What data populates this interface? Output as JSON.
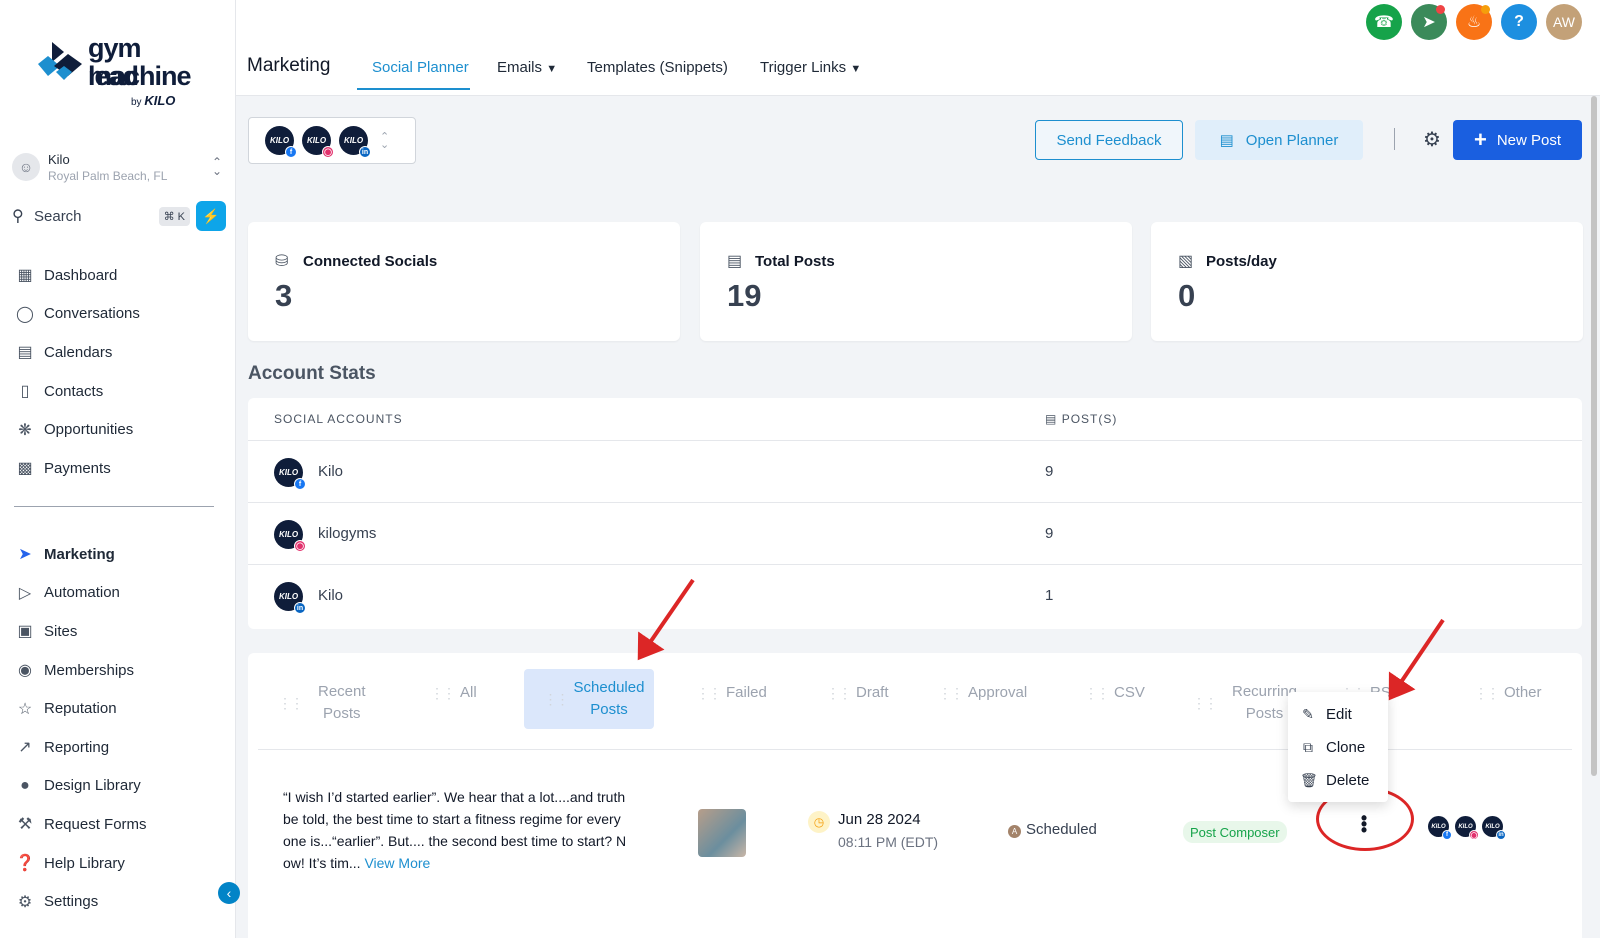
{
  "brand": {
    "logo_line1": "gym lead",
    "logo_line2": "machine",
    "logo_by": "by",
    "logo_by_brand": "KILO"
  },
  "account": {
    "name": "Kilo",
    "location": "Royal Palm Beach, FL"
  },
  "search": {
    "label": "Search",
    "shortcut": "⌘ K"
  },
  "sidebar": {
    "items": [
      {
        "label": "Dashboard",
        "icon": "dashboard-icon"
      },
      {
        "label": "Conversations",
        "icon": "chat-icon"
      },
      {
        "label": "Calendars",
        "icon": "calendar-icon"
      },
      {
        "label": "Contacts",
        "icon": "contacts-icon"
      },
      {
        "label": "Opportunities",
        "icon": "opportunities-icon"
      },
      {
        "label": "Payments",
        "icon": "payments-icon"
      }
    ],
    "items2": [
      {
        "label": "Marketing",
        "icon": "send-icon"
      },
      {
        "label": "Automation",
        "icon": "automation-icon"
      },
      {
        "label": "Sites",
        "icon": "sites-icon"
      },
      {
        "label": "Memberships",
        "icon": "memberships-icon"
      },
      {
        "label": "Reputation",
        "icon": "star-icon"
      },
      {
        "label": "Reporting",
        "icon": "chart-icon"
      },
      {
        "label": "Design Library",
        "icon": "palette-icon"
      },
      {
        "label": "Request Forms",
        "icon": "wrench-icon"
      },
      {
        "label": "Help Library",
        "icon": "help-icon"
      },
      {
        "label": "Settings",
        "icon": "gear-icon"
      }
    ]
  },
  "header": {
    "title": "Marketing",
    "tabs": [
      "Social Planner",
      "Emails",
      "Templates (Snippets)",
      "Trigger Links"
    ],
    "user_initials": "AW"
  },
  "toolbar": {
    "send_feedback": "Send Feedback",
    "open_planner": "Open Planner",
    "new_post": "New Post"
  },
  "stats": [
    {
      "label": "Connected Socials",
      "value": "3"
    },
    {
      "label": "Total Posts",
      "value": "19"
    },
    {
      "label": "Posts/day",
      "value": "0"
    }
  ],
  "account_stats": {
    "title": "Account Stats",
    "col_accounts": "SOCIAL ACCOUNTS",
    "col_posts": "POST(S)",
    "rows": [
      {
        "name": "Kilo",
        "network": "facebook",
        "posts": "9"
      },
      {
        "name": "kilogyms",
        "network": "instagram",
        "posts": "9"
      },
      {
        "name": "Kilo",
        "network": "linkedin",
        "posts": "1"
      }
    ]
  },
  "post_tabs": {
    "recent1": "Recent",
    "recent2": "Posts",
    "all": "All",
    "scheduled1": "Scheduled",
    "scheduled2": "Posts",
    "failed": "Failed",
    "draft": "Draft",
    "approval": "Approval",
    "csv": "CSV",
    "recurring1": "Recurring",
    "recurring2": "Posts",
    "rss": "RS",
    "other": "Other"
  },
  "post": {
    "text": "“I wish I’d started earlier”. We hear that a lot....and truth be told, the best time to start a fitness regime for everyone is...“earlier”.  But.... the second best time to start? Now! It’s tim...",
    "view_more": "View More",
    "date": "Jun 28 2024",
    "time": "08:11 PM (EDT)",
    "status": "Scheduled",
    "source": "Post Composer",
    "kebab": "⋮"
  },
  "menu": {
    "edit": "Edit",
    "clone": "Clone",
    "delete": "Delete"
  },
  "avatar_text": "KILO",
  "colors": {
    "accent": "#1d8fcf",
    "primary_button": "#1a5fe0",
    "annotation": "#dc2626"
  }
}
